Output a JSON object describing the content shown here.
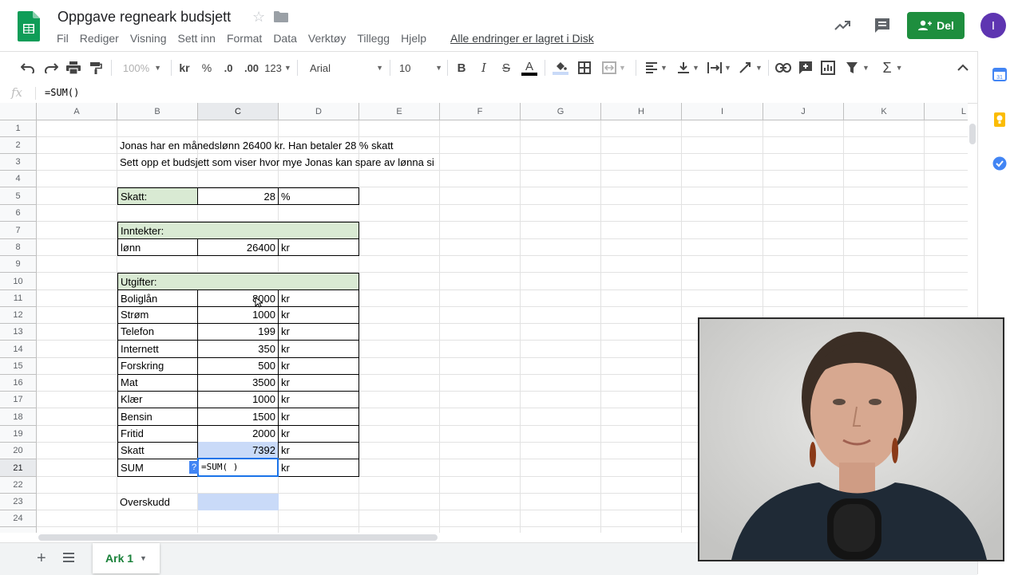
{
  "app": {
    "doc_title": "Oppgave regneark budsjett",
    "save_status": "Alle endringer er lagret i Disk",
    "share_label": "Del",
    "avatar_initial": "I",
    "accent": "#1e8e3e"
  },
  "menu": [
    "Fil",
    "Rediger",
    "Visning",
    "Sett inn",
    "Format",
    "Data",
    "Verktøy",
    "Tillegg",
    "Hjelp"
  ],
  "toolbar": {
    "zoom": "100%",
    "currency": "kr",
    "percent": "%",
    "decrease_decimals": ".0",
    "increase_decimals": ".00",
    "more_formats": "123",
    "font": "Arial",
    "font_size": "10",
    "bold": "B",
    "italic": "I",
    "strike": "S",
    "text_color": "A",
    "sum": "Σ"
  },
  "formula_bar": {
    "fx": "fx",
    "content": "=SUM()"
  },
  "grid": {
    "columns": [
      "A",
      "B",
      "C",
      "D",
      "E",
      "F",
      "G",
      "H",
      "I",
      "J",
      "K",
      "L"
    ],
    "rows": [
      "1",
      "2",
      "3",
      "4",
      "5",
      "6",
      "7",
      "8",
      "9",
      "10",
      "11",
      "12",
      "13",
      "14",
      "15",
      "16",
      "17",
      "18",
      "19",
      "20",
      "21",
      "22",
      "23",
      "24"
    ],
    "selected_column": "C",
    "selected_row": "21",
    "text_b2": "Jonas har en månedslønn 26400 kr. Han betaler 28 % skatt",
    "text_b3": "Sett opp et budsjett som viser hvor mye Jonas kan spare av lønna si",
    "skatt_label": "Skatt:",
    "skatt_value": "28",
    "skatt_unit": "%",
    "inntekter_label": "Inntekter:",
    "lonn_label": "lønn",
    "lonn_value": "26400",
    "lonn_unit": "kr",
    "utgifter_label": "Utgifter:",
    "expenses": [
      {
        "label": "Boliglån",
        "value": "8000",
        "unit": "kr"
      },
      {
        "label": "Strøm",
        "value": "1000",
        "unit": "kr"
      },
      {
        "label": "Telefon",
        "value": "199",
        "unit": "kr"
      },
      {
        "label": "Internett",
        "value": "350",
        "unit": "kr"
      },
      {
        "label": "Forskring",
        "value": "500",
        "unit": "kr"
      },
      {
        "label": "Mat",
        "value": "3500",
        "unit": "kr"
      },
      {
        "label": "Klær",
        "value": "1000",
        "unit": "kr"
      },
      {
        "label": "Bensin",
        "value": "1500",
        "unit": "kr"
      },
      {
        "label": "Fritid",
        "value": "2000",
        "unit": "kr"
      },
      {
        "label": "Skatt",
        "value": "7392",
        "unit": "kr"
      }
    ],
    "sum_label": "SUM",
    "sum_editing": "=SUM( )",
    "sum_unit": "kr",
    "help_badge": "?",
    "overskudd_label": "Overskudd"
  },
  "sheets": {
    "active_tab": "Ark 1"
  }
}
